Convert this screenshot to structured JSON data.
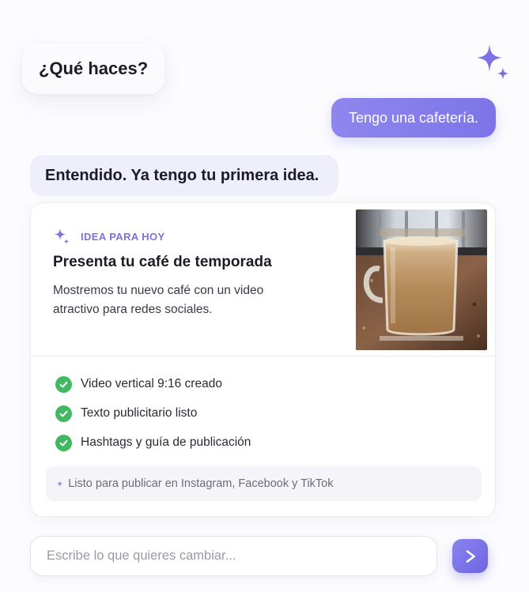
{
  "chat": {
    "question": "¿Qué haces?",
    "user_reply": "Tengo una cafetería.",
    "bot_reply": "Entendido. Ya tengo tu primera idea."
  },
  "idea_card": {
    "tag": "IDEA PARA HOY",
    "title": "Presenta tu café de temporada",
    "description": "Mostremos tu nuevo café con un video atractivo para redes sociales.",
    "image_subject": "latte in glass mug",
    "checklist": [
      {
        "label": "Video vertical 9:16 creado",
        "icon": "check-circle-icon",
        "status": "done"
      },
      {
        "label": "Texto publicitario listo",
        "icon": "check-circle-icon",
        "status": "done"
      },
      {
        "label": "Hashtags y guía de publicación",
        "icon": "check-circle-icon",
        "status": "done"
      }
    ],
    "ready_note": "Listo para publicar en Instagram, Facebook y TikTok"
  },
  "composer": {
    "placeholder": "Escribe lo que quieres cambiar...",
    "value": "",
    "send_icon": "send-arrow-icon"
  },
  "colors": {
    "accent": "#7d74e8",
    "bot_bubble": "#efeefb",
    "success": "#43b762"
  },
  "icons": {
    "decoration": "sparkle-icon",
    "idea": "sparkle-icon"
  }
}
